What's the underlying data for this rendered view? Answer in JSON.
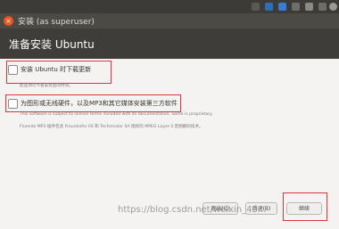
{
  "window": {
    "title": "安装 (as superuser)",
    "close_glyph": "×"
  },
  "header": {
    "title": "准备安装 Ubuntu"
  },
  "options": [
    {
      "label": "安装 Ubuntu 时下载更新",
      "subtext": "此选项可节省安装后的时间。"
    },
    {
      "label": "为图形或无线硬件，以及MP3和其它媒体安装第三方软件",
      "subtext": "This software is subject to license terms included with its documentation. Some is proprietary.",
      "subtext2": "Fluendo MP3 插件包含 Fraunhofer IIS 和 Technicolor SA 授权的 MPEG Layer-3 音频解码技术。"
    }
  ],
  "buttons": {
    "quit": "退出(Q)",
    "back": "后退(B)",
    "continue": "继续"
  },
  "watermark": "https://blog.csdn.net/weixin_43..."
}
